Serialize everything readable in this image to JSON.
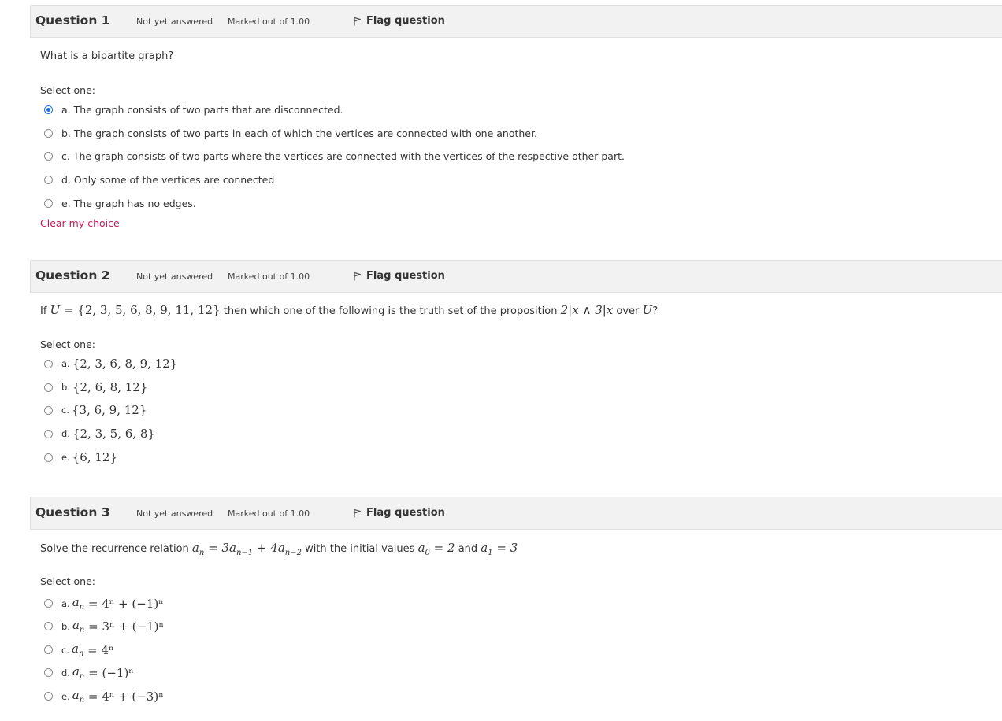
{
  "common": {
    "state": "Not yet answered",
    "mark": "Marked out of 1.00",
    "flag": "Flag question",
    "select_one": "Select one:"
  },
  "q1": {
    "title": "Question 1",
    "text": "What is a bipartite graph?",
    "options": [
      "a. The graph consists of two parts that are disconnected.",
      "b. The graph consists of two parts in each of which the vertices are connected with one another.",
      "c. The graph consists of two parts where the vertices are connected with the vertices of the respective other part.",
      "d. Only some of the vertices are connected",
      "e. The graph has no edges."
    ],
    "selected": 0,
    "clear": "Clear my choice"
  },
  "q2": {
    "title": "Question 2",
    "text_prefix": "If ",
    "text_u": "U",
    "text_set": " = {2, 3, 5, 6, 8, 9, 11, 12}",
    "text_mid": " then which one of the following is the truth set of the proposition ",
    "text_prop": "2|x ∧ 3|x",
    "text_over": " over ",
    "text_end": "?",
    "options": [
      {
        "letter": "a.",
        "math": "{2, 3, 6, 8, 9, 12}"
      },
      {
        "letter": "b.",
        "math": "{2, 6, 8, 12}"
      },
      {
        "letter": "c.",
        "math": "{3, 6, 9, 12}"
      },
      {
        "letter": "d.",
        "math": "{2, 3, 5, 6, 8}"
      },
      {
        "letter": "e.",
        "math": "{6, 12}"
      }
    ]
  },
  "q3": {
    "title": "Question 3",
    "text_prefix": "Solve the recurrence relation ",
    "text_mid": " with the initial values ",
    "text_and": " and ",
    "options": [
      {
        "letter": "a.",
        "rhs": "4ⁿ + (−1)ⁿ"
      },
      {
        "letter": "b.",
        "rhs": "3ⁿ + (−1)ⁿ"
      },
      {
        "letter": "c.",
        "rhs": "4ⁿ"
      },
      {
        "letter": "d.",
        "rhs": "(−1)ⁿ"
      },
      {
        "letter": "e.",
        "rhs": "4ⁿ + (−3)ⁿ"
      }
    ]
  }
}
